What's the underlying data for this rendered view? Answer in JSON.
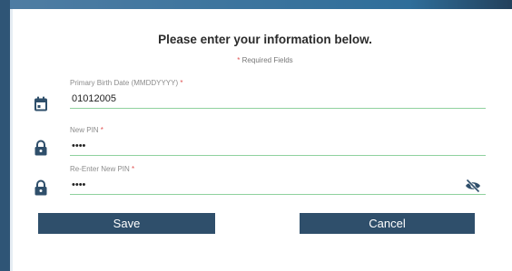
{
  "form": {
    "heading": "Please enter your information below.",
    "required_star": "*",
    "required_note": "Required Fields",
    "fields": [
      {
        "label": "Primary Birth Date (MMDDYYYY)",
        "star": "*",
        "value": "01012005",
        "icon": "calendar-icon"
      },
      {
        "label": "New PIN",
        "star": "*",
        "value": "••••",
        "icon": "lock-icon"
      },
      {
        "label": "Re-Enter New PIN",
        "star": "*",
        "value": "••••",
        "icon": "lock-icon",
        "trailing_icon": "eye-off-icon"
      }
    ]
  },
  "actions": {
    "save_label": "Save",
    "cancel_label": "Cancel"
  },
  "colors": {
    "button_bg": "#2f4f6b",
    "underline": "#8fd19e",
    "required": "#e05353",
    "accent_bar": "#2f5576"
  }
}
